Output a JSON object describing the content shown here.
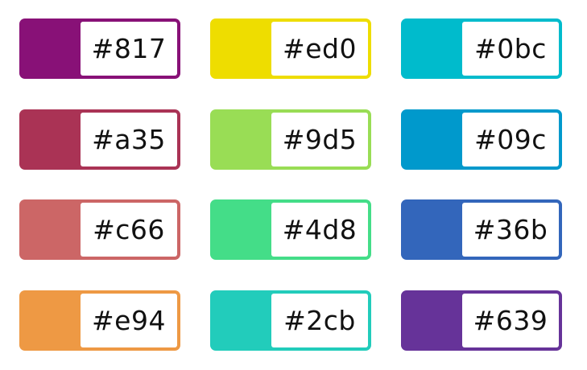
{
  "swatches": [
    {
      "label": "#817",
      "color": "#881177"
    },
    {
      "label": "#ed0",
      "color": "#eedd00"
    },
    {
      "label": "#0bc",
      "color": "#00bbcc"
    },
    {
      "label": "#a35",
      "color": "#aa3355"
    },
    {
      "label": "#9d5",
      "color": "#99dd55"
    },
    {
      "label": "#09c",
      "color": "#0099cc"
    },
    {
      "label": "#c66",
      "color": "#cc6666"
    },
    {
      "label": "#4d8",
      "color": "#44dd88"
    },
    {
      "label": "#36b",
      "color": "#3366bb"
    },
    {
      "label": "#e94",
      "color": "#ee9944"
    },
    {
      "label": "#2cb",
      "color": "#22ccbb"
    },
    {
      "label": "#639",
      "color": "#663399"
    }
  ]
}
